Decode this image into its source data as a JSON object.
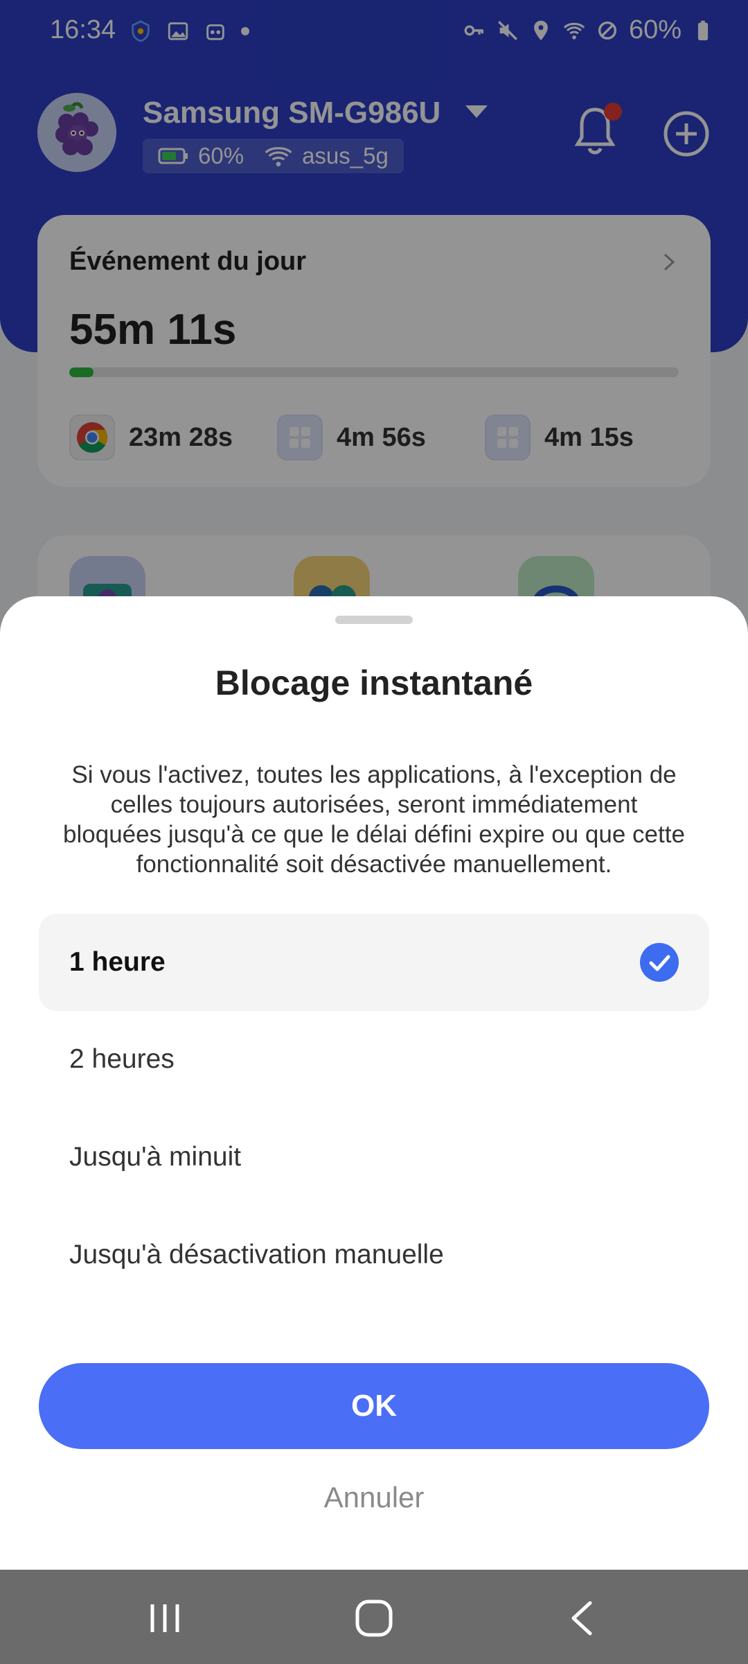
{
  "status_bar": {
    "time": "16:34",
    "battery": "60%",
    "left_icons": [
      "vpn-shield-icon",
      "gallery-icon",
      "game-icon",
      "dot-icon"
    ],
    "right_icons": [
      "key-icon",
      "mute-icon",
      "location-icon",
      "wifi-icon",
      "block-icon",
      "battery-icon"
    ]
  },
  "header": {
    "device_name": "Samsung SM-G986U",
    "battery": "60%",
    "wifi": "asus_5g"
  },
  "today_card": {
    "title": "Événement du jour",
    "total_time": "55m 11s",
    "progress": 0.04,
    "apps": [
      {
        "icon": "chrome-icon",
        "time": "23m 28s"
      },
      {
        "icon": "app-grid-icon",
        "time": "4m 56s"
      },
      {
        "icon": "app-grid-icon",
        "time": "4m 15s"
      }
    ]
  },
  "sheet": {
    "title": "Blocage instantané",
    "description": "Si vous l'activez, toutes les applications, à l'exception de celles toujours autorisées, seront immédiatement bloquées jusqu'à ce que le délai défini expire ou que cette fonctionnalité soit désactivée manuellement.",
    "options": [
      {
        "label": "1 heure",
        "selected": true
      },
      {
        "label": "2 heures",
        "selected": false
      },
      {
        "label": "Jusqu'à minuit",
        "selected": false
      },
      {
        "label": "Jusqu'à désactivation manuelle",
        "selected": false
      }
    ],
    "ok_label": "OK",
    "cancel_label": "Annuler"
  },
  "colors": {
    "header_blue": "#2d3fc4",
    "primary_button": "#4a6ef5",
    "check": "#3d6cf0",
    "progress": "#2db83d"
  }
}
